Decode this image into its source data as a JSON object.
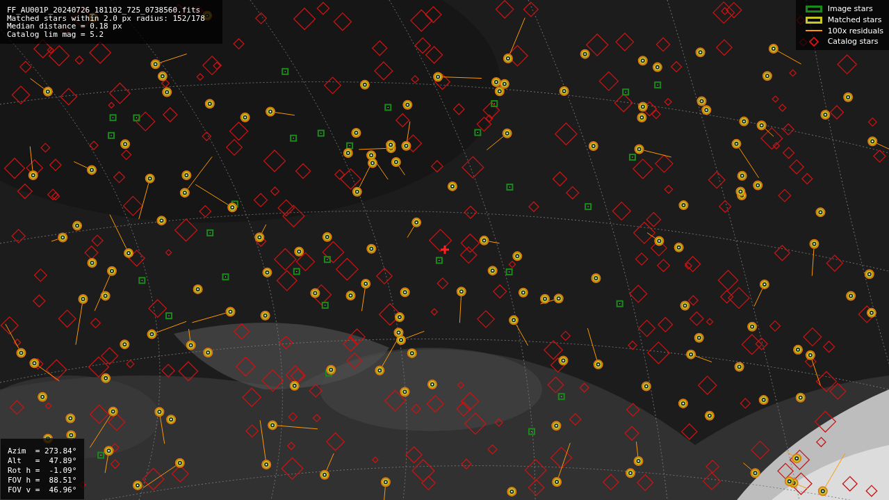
{
  "info_panel": {
    "lines": [
      "FF_AU001P_20240726_181102_725_0738560.fits",
      "Matched stars within 2.0 px radius: 152/178",
      "Median distance = 0.18 px",
      "Catalog lim mag = 5.2"
    ]
  },
  "legend": [
    {
      "label": "Image stars",
      "kind": "box",
      "color": "#1a8a1a"
    },
    {
      "label": "Matched stars",
      "kind": "box",
      "color": "#c8c81e"
    },
    {
      "label": "100x residuals",
      "kind": "line",
      "color": "#ff9900"
    },
    {
      "label": "Catalog stars",
      "kind": "diamond",
      "color": "#c81414"
    }
  ],
  "pointing_panel": {
    "lines": [
      "Azim  = 273.84°",
      "Alt   =  47.89°",
      "Rot h =  -1.09°",
      "FOV h =  88.51°",
      "FOV v =  46.96°"
    ]
  }
}
